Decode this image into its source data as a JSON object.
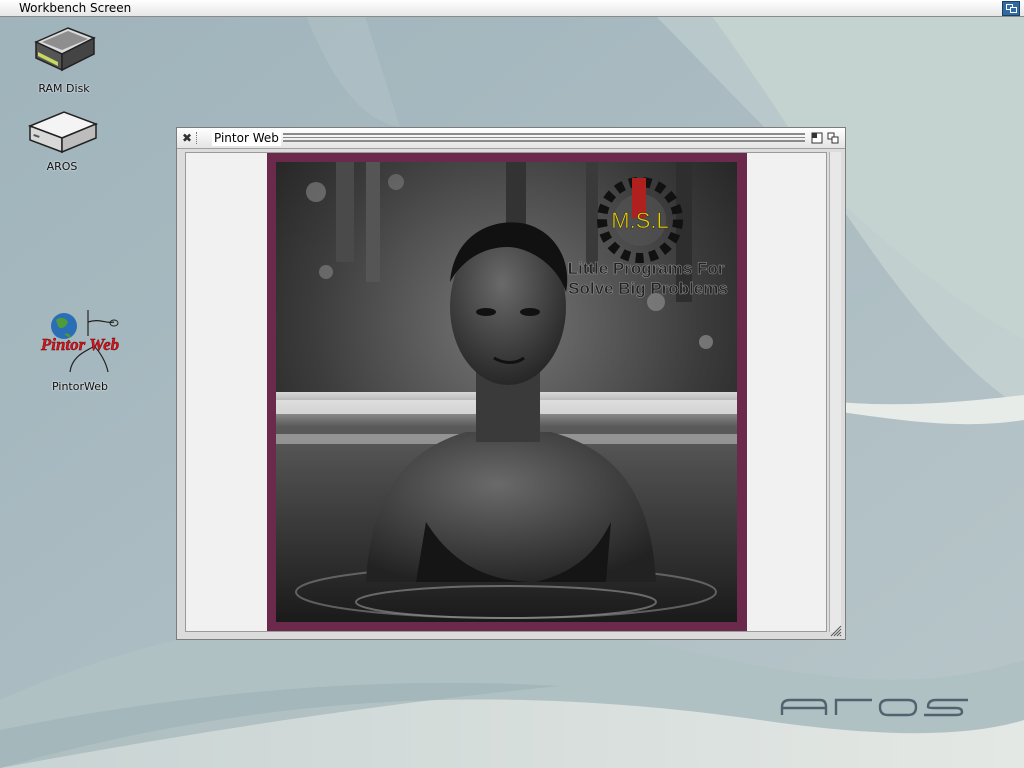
{
  "screen": {
    "title": "Workbench Screen",
    "depth_icon": "screen-depth-icon"
  },
  "desktop_icons": [
    {
      "label": "RAM Disk",
      "icon": "ram-disk-drive-icon"
    },
    {
      "label": "AROS",
      "icon": "aros-drive-icon"
    },
    {
      "label": "PintorWeb",
      "icon": "pintorweb-app-icon",
      "logo_text": "Pintor Web"
    }
  ],
  "window": {
    "title": "Pintor Web",
    "close_icon": "close-icon",
    "zoom_icon": "zoom-icon",
    "depth_icon": "window-depth-icon",
    "picture": {
      "overlay_logo": "M.S.L",
      "overlay_line1": "Little Programs For",
      "overlay_line2": "Solve Big Problems"
    }
  },
  "branding": {
    "aros_logo": "aros"
  },
  "colors": {
    "frame": "#6b2a4c",
    "overlay_logo": "#e8d000",
    "screen_depth": "#2f6aa3"
  }
}
